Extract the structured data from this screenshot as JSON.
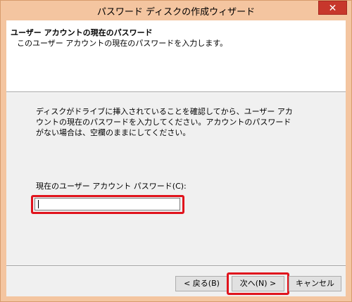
{
  "window": {
    "title": "パスワード ディスクの作成ウィザード",
    "close_glyph": "✕"
  },
  "header": {
    "title": "ユーザー アカウントの現在のパスワード",
    "subtitle": "このユーザー アカウントの現在のパスワードを入力します。"
  },
  "body": {
    "description": "ディスクがドライブに挿入されていることを確認してから、ユーザー アカウントの現在のパスワードを入力してください。アカウントのパスワードがない場合は、空欄のままにしてください。",
    "password_label": "現在のユーザー アカウント パスワード(C):",
    "password_value": ""
  },
  "buttons": {
    "back": "< 戻る(B)",
    "next": "次へ(N) >",
    "cancel": "キャンセル"
  },
  "colors": {
    "title_bar": "#f4c5a0",
    "close_button": "#c7372c",
    "highlight": "#e0141d"
  }
}
